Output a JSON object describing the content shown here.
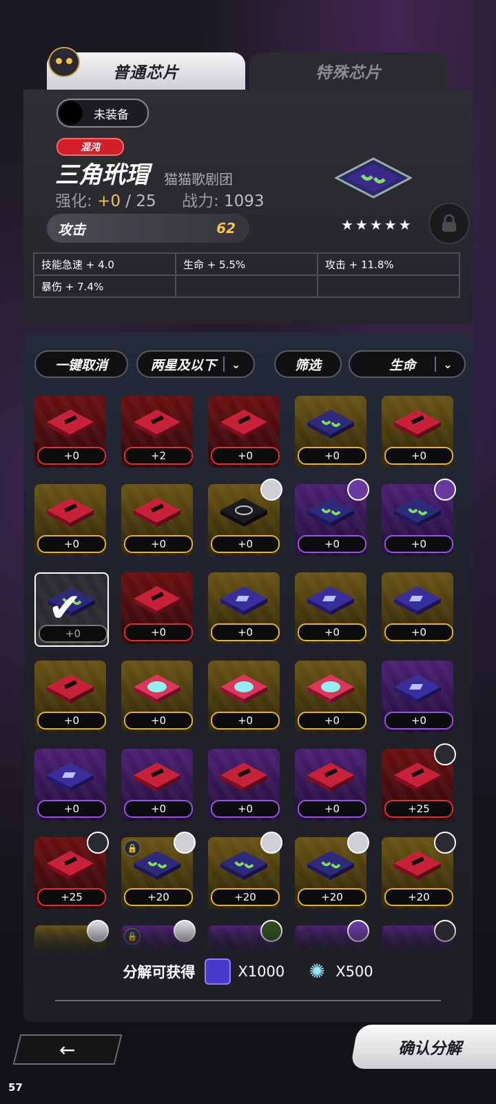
{
  "tabs": {
    "normal": "普通芯片",
    "special": "特殊芯片"
  },
  "equip_status": "未装备",
  "chip": {
    "rarity_tag": "混沌",
    "name": "三角玳瑁",
    "set_name": "猫猫歌剧团",
    "enhance_label": "强化:",
    "enhance_current": "+0",
    "enhance_sep": "/",
    "enhance_max": "25",
    "power_label": "战力:",
    "power": "1093",
    "main_stat_label": "攻击",
    "main_stat_value": "62",
    "stars": "★★★★★",
    "substats": [
      [
        "技能急速 + 4.0",
        "生命 + 5.5%",
        "攻击 + 11.8%"
      ],
      [
        "暴伤 + 7.4%",
        "",
        ""
      ]
    ]
  },
  "filters": {
    "cancel_all": "一键取消",
    "star_filter": "两星及以下",
    "filter": "筛选",
    "sort": "生命"
  },
  "grid": [
    {
      "frame": "red",
      "art": "red",
      "level": "+0"
    },
    {
      "frame": "red",
      "art": "red",
      "level": "+2"
    },
    {
      "frame": "red",
      "art": "red",
      "level": "+0"
    },
    {
      "frame": "gold",
      "art": "navy-green",
      "level": "+0"
    },
    {
      "frame": "gold",
      "art": "red",
      "level": "+0"
    },
    {
      "frame": "gold",
      "art": "red",
      "level": "+0"
    },
    {
      "frame": "gold",
      "art": "red",
      "level": "+0"
    },
    {
      "frame": "gold",
      "art": "black-swirl",
      "level": "+0",
      "badge": "light"
    },
    {
      "frame": "purple",
      "art": "navy-green",
      "level": "+0",
      "badge": "purp"
    },
    {
      "frame": "purple",
      "art": "navy-green",
      "level": "+0",
      "badge": "purp"
    },
    {
      "frame": "sel",
      "art": "navy-green",
      "level": "+0",
      "selected": true
    },
    {
      "frame": "red",
      "art": "red",
      "level": "+0"
    },
    {
      "frame": "gold",
      "art": "navy",
      "level": "+0"
    },
    {
      "frame": "gold",
      "art": "navy",
      "level": "+0"
    },
    {
      "frame": "gold",
      "art": "navy",
      "level": "+0"
    },
    {
      "frame": "gold",
      "art": "red",
      "level": "+0"
    },
    {
      "frame": "gold",
      "art": "pink-cyan",
      "level": "+0"
    },
    {
      "frame": "gold",
      "art": "pink-cyan",
      "level": "+0"
    },
    {
      "frame": "gold",
      "art": "pink-cyan",
      "level": "+0"
    },
    {
      "frame": "purple",
      "art": "navy",
      "level": "+0"
    },
    {
      "frame": "purple",
      "art": "navy",
      "level": "+0"
    },
    {
      "frame": "purple",
      "art": "red",
      "level": "+0"
    },
    {
      "frame": "purple",
      "art": "red",
      "level": "+0"
    },
    {
      "frame": "purple",
      "art": "red",
      "level": "+0"
    },
    {
      "frame": "red",
      "art": "red",
      "level": "+25",
      "badge": "dark"
    },
    {
      "frame": "red",
      "art": "red",
      "level": "+25",
      "badge": "dark"
    },
    {
      "frame": "gold",
      "art": "navy-green",
      "level": "+20",
      "badge": "light",
      "lock": true
    },
    {
      "frame": "gold",
      "art": "navy-green",
      "level": "+20",
      "badge": "light"
    },
    {
      "frame": "gold",
      "art": "navy-green",
      "level": "+20",
      "badge": "light"
    },
    {
      "frame": "gold",
      "art": "red",
      "level": "+20",
      "badge": "dark"
    }
  ],
  "partial_row_badges": [
    "light",
    "light",
    "green",
    "purp",
    "dark"
  ],
  "reward": {
    "label": "分解可获得",
    "item1_qty": "X1000",
    "item2_qty": "X500"
  },
  "confirm": "确认分解",
  "fps": "57",
  "colors": {
    "gold": "#f3c64a",
    "red": "#d31f2a",
    "purple": "#9a55e0"
  }
}
